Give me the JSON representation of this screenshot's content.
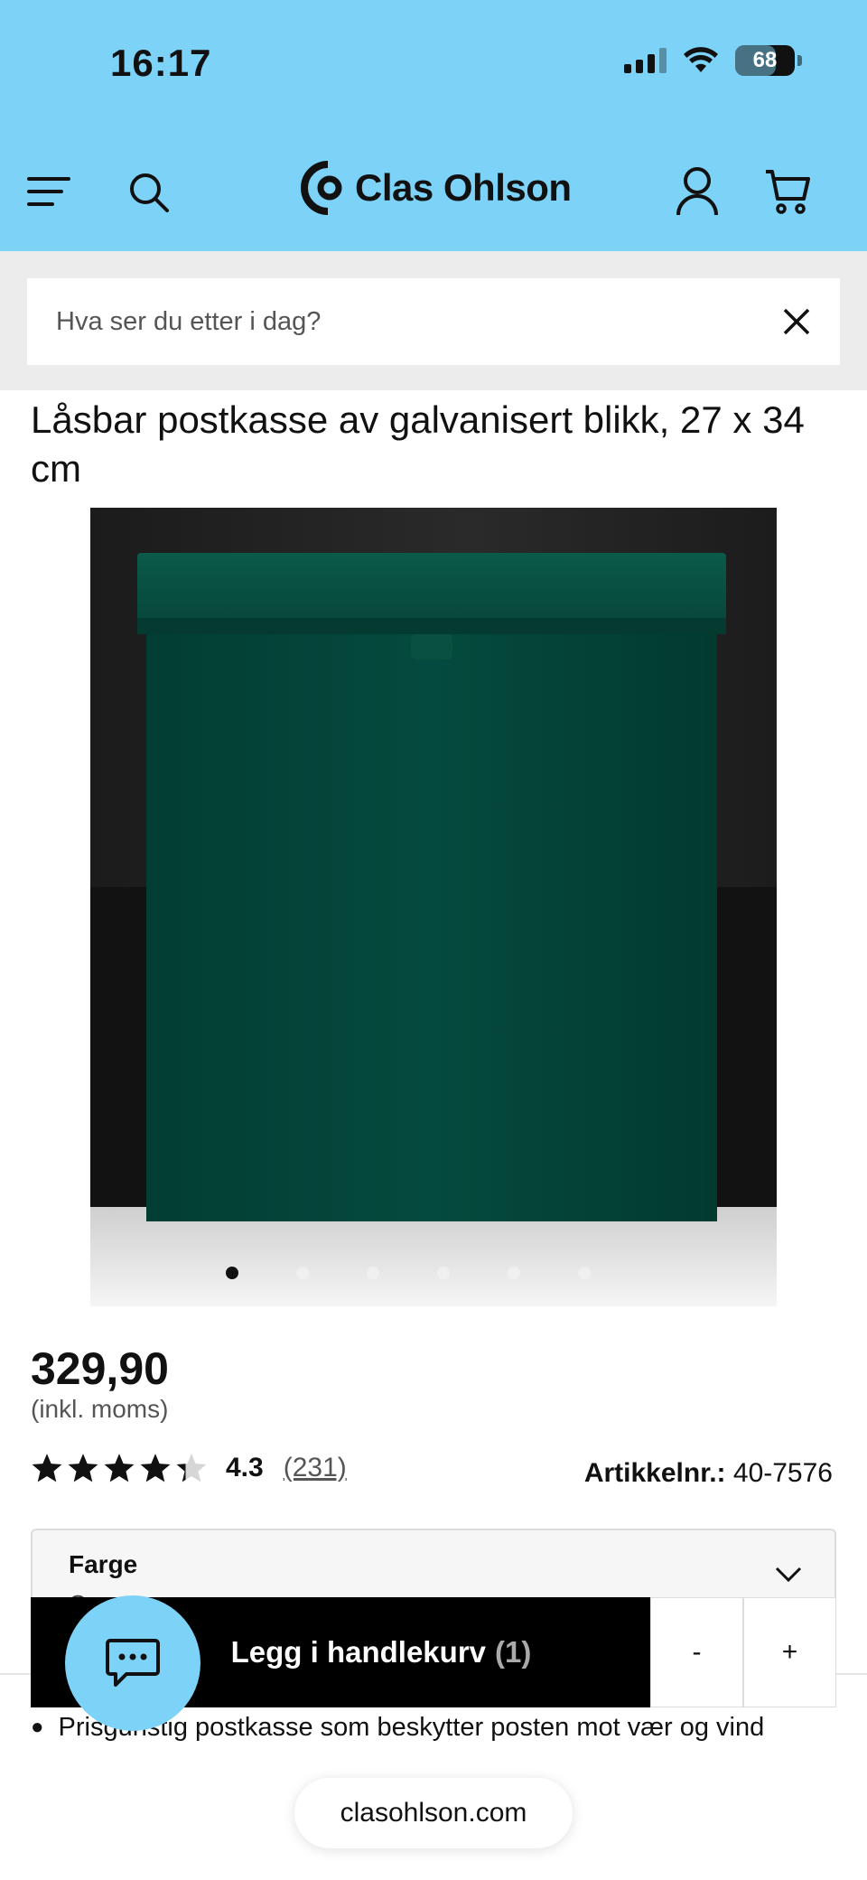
{
  "status_bar": {
    "time": "16:17",
    "battery": "68"
  },
  "header": {
    "logo_text": "Clas Ohlson"
  },
  "search": {
    "placeholder": "Hva ser du etter i dag?"
  },
  "product": {
    "title": "Låsbar postkasse av galvanisert blikk, 27 x 34 cm",
    "price": "329,90",
    "vat_note": "(inkl. moms)",
    "rating": {
      "stars": 4.3,
      "value": "4.3",
      "count": "(231)"
    },
    "article_label": "Artikkelnr.:",
    "article_number": "40-7576",
    "color_label": "Farge",
    "color_value": "Grønn",
    "image_count": 6,
    "active_image": 0,
    "bullet": "Prisgunstig postkasse som beskytter posten mot vær og vind"
  },
  "cart": {
    "add_label": "Legg i handlekurv",
    "quantity": "(1)",
    "minus": "-",
    "plus": "+"
  },
  "browser": {
    "url": "clasohlson.com"
  },
  "colors": {
    "brand": "#7dd3f7",
    "button": "#000000"
  }
}
